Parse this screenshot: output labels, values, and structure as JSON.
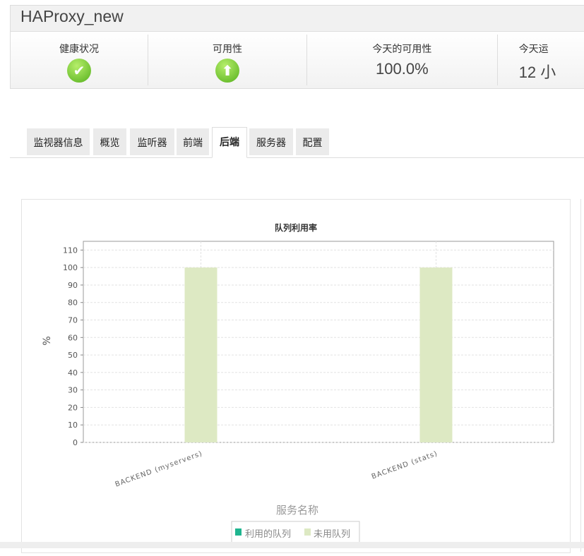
{
  "header": {
    "title": "HAProxy_new",
    "stats": [
      {
        "label": "健康状况",
        "icon": "check-icon"
      },
      {
        "label": "可用性",
        "icon": "up-arrow-icon"
      },
      {
        "label": "今天的可用性",
        "value": "100.0%"
      },
      {
        "label": "今天运",
        "value": "12 小"
      }
    ]
  },
  "tabs": [
    "监视器信息",
    "概览",
    "监听器",
    "前端",
    "后端",
    "服务器",
    "配置"
  ],
  "active_tab": "后端",
  "chart_data": {
    "type": "bar",
    "stacked": true,
    "title": "队列利用率",
    "xlabel": "服务名称",
    "ylabel": "%",
    "categories": [
      "BACKEND (myservers)",
      "BACKEND (stats)"
    ],
    "series": [
      {
        "name": "利用的队列",
        "values": [
          0,
          0
        ],
        "color": "#1fb58f"
      },
      {
        "name": "未用队列",
        "values": [
          100,
          100
        ],
        "color": "#dde9c3"
      }
    ],
    "yticks": [
      0,
      10,
      20,
      30,
      40,
      50,
      60,
      70,
      80,
      90,
      100,
      110
    ],
    "ylim": [
      0,
      115
    ],
    "grid": true,
    "legend": "bottom"
  }
}
